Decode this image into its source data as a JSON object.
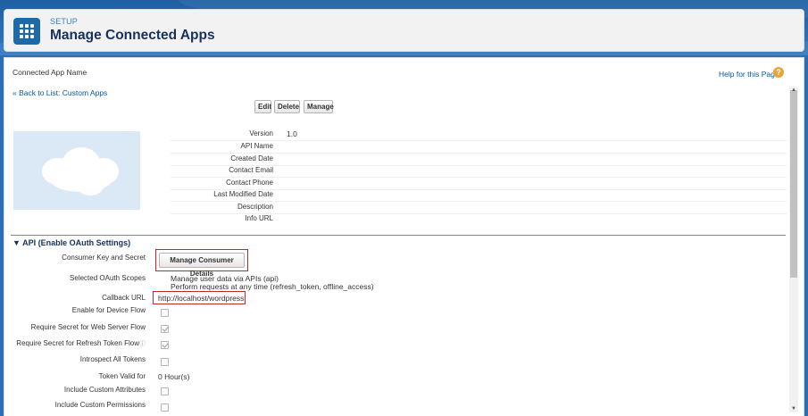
{
  "header": {
    "super_title": "SETUP",
    "title": "Manage Connected Apps"
  },
  "content": {
    "app_name_label": "Connected App Name",
    "help_link": "Help for this Page",
    "back_link": "« Back to List: Custom Apps",
    "buttons": {
      "edit": "Edit",
      "delete": "Delete",
      "manage": "Manage"
    }
  },
  "details": {
    "fields": [
      {
        "label": "Version",
        "value": "1.0"
      },
      {
        "label": "API Name",
        "value": ""
      },
      {
        "label": "Created Date",
        "value": ""
      },
      {
        "label": "Contact Email",
        "value": ""
      },
      {
        "label": "Contact Phone",
        "value": ""
      },
      {
        "label": "Last Modified Date",
        "value": ""
      },
      {
        "label": "Description",
        "value": ""
      },
      {
        "label": "Info URL",
        "value": ""
      }
    ]
  },
  "api_section": {
    "title": "▼ API (Enable OAuth Settings)",
    "consumer_key_label": "Consumer Key and Secret",
    "consumer_button": "Manage Consumer Details",
    "scopes_label": "Selected OAuth Scopes",
    "scopes": [
      "Manage user data via APIs (api)",
      "Perform requests at any time (refresh_token, offline_access)"
    ],
    "callback_label": "Callback URL",
    "callback_value": "http://localhost/wordpress",
    "device_flow_label": "Enable for Device Flow",
    "web_server_label": "Require Secret for Web Server Flow",
    "refresh_token_label": "Require Secret for Refresh Token Flow",
    "introspect_label": "Introspect All Tokens",
    "token_valid_label": "Token Valid for",
    "token_valid_value": "0 Hour(s)",
    "custom_attr_label": "Include Custom Attributes",
    "custom_perm_label": "Include Custom Permissions"
  },
  "checkboxes": {
    "device_flow": false,
    "web_server": true,
    "refresh_token": true,
    "introspect": false,
    "custom_attr": false,
    "custom_perm": false
  },
  "colors": {
    "brand_blue": "#1d6aa8",
    "link": "#015ba7",
    "highlight_red": "#c2272d",
    "help_orange": "#e8a535"
  }
}
